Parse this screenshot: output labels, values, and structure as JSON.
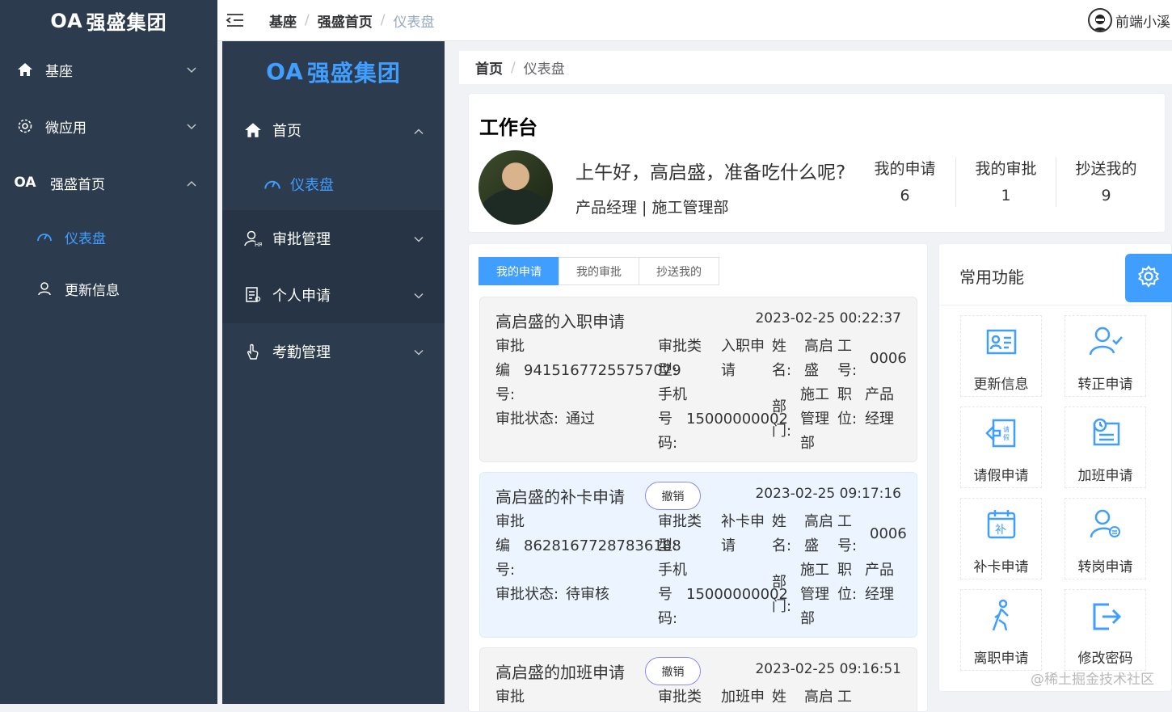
{
  "sidebar1": {
    "logo": "强盛集团",
    "logo_prefix": "OA",
    "items": [
      {
        "label": "基座"
      },
      {
        "label": "微应用"
      },
      {
        "label": "强盛首页"
      }
    ],
    "subitems": [
      {
        "label": "仪表盘"
      },
      {
        "label": "更新信息"
      }
    ]
  },
  "sidebar2": {
    "logo": "强盛集团",
    "logo_prefix": "OA",
    "items": [
      {
        "label": "首页"
      },
      {
        "label": "审批管理"
      },
      {
        "label": "个人申请"
      },
      {
        "label": "考勤管理"
      }
    ],
    "subitems": [
      {
        "label": "仪表盘"
      }
    ]
  },
  "topbar": {
    "crumbs": [
      "基座",
      "强盛首页",
      "仪表盘"
    ],
    "sep": "/",
    "user": "前端小溪"
  },
  "crumb2": {
    "items": [
      "首页",
      "仪表盘"
    ],
    "sep": "/"
  },
  "workbench": {
    "title": "工作台",
    "greeting": "上午好，高启盛，准备吃什么呢?",
    "role": "产品经理 | 施工管理部",
    "stats": [
      {
        "label": "我的申请",
        "value": "6"
      },
      {
        "label": "我的审批",
        "value": "1"
      },
      {
        "label": "抄送我的",
        "value": "9"
      }
    ]
  },
  "tabs": [
    "我的申请",
    "我的审批",
    "抄送我的"
  ],
  "applications": [
    {
      "title": "高启盛的入职申请",
      "time": "2023-02-25 00:22:37",
      "cancel": "",
      "no_label_1": "审批",
      "no_label_2": "编",
      "no_label_3": "号:",
      "no_value": "94151677255757079",
      "type_label": "审批类型:",
      "type_label_a": "审批类",
      "type_label_b": "型:",
      "type_value_a": "入职申",
      "type_value_b": "请",
      "name_label_a": "姓",
      "name_label_b": "名:",
      "name_value_a": "高启",
      "name_value_b": "盛",
      "empno_label_a": "工",
      "empno_label_b": "号:",
      "empno_value": "0006",
      "status": "审批状态:通过",
      "status_label": "审批状态:",
      "status_value": "通过",
      "phone_label_a": "手机",
      "phone_label_b": "号",
      "phone_label_c": "码:",
      "phone_value": "15000000002",
      "dept_label_a": "部",
      "dept_label_b": "门:",
      "dept_value_a": "施工",
      "dept_value_b": "管理",
      "dept_value_c": "部",
      "pos_label_a": "职",
      "pos_label_b": "位:",
      "pos_value_a": "产品",
      "pos_value_b": "经理"
    },
    {
      "title": "高启盛的补卡申请",
      "time": "2023-02-25 09:17:16",
      "cancel": "撤销",
      "no_label_1": "审批",
      "no_label_2": "编",
      "no_label_3": "号:",
      "no_value": "86281677287836188",
      "type_label_a": "审批类",
      "type_label_b": "型:",
      "type_value_a": "补卡申",
      "type_value_b": "请",
      "name_label_a": "姓",
      "name_label_b": "名:",
      "name_value_a": "高启",
      "name_value_b": "盛",
      "empno_label_a": "工",
      "empno_label_b": "号:",
      "empno_value": "0006",
      "status_label": "审批状态:",
      "status_value": "待审核",
      "phone_label_a": "手机",
      "phone_label_b": "号",
      "phone_label_c": "码:",
      "phone_value": "15000000002",
      "dept_label_a": "部",
      "dept_label_b": "门:",
      "dept_value_a": "施工",
      "dept_value_b": "管理",
      "dept_value_c": "部",
      "pos_label_a": "职",
      "pos_label_b": "位:",
      "pos_value_a": "产品",
      "pos_value_b": "经理"
    },
    {
      "title": "高启盛的加班申请",
      "time": "2023-02-25 09:16:51",
      "cancel": "撤销",
      "no_label_1": "审批",
      "type_label_a": "审批类",
      "type_value_a": "加班申",
      "name_label_a": "姓",
      "name_value_a": "高启",
      "empno_label_a": "工"
    }
  ],
  "functions": {
    "title": "常用功能",
    "items": [
      {
        "label": "更新信息",
        "icon": "id-card-icon"
      },
      {
        "label": "转正申请",
        "icon": "user-check-icon"
      },
      {
        "label": "请假申请",
        "icon": "leave-icon"
      },
      {
        "label": "加班申请",
        "icon": "overtime-icon"
      },
      {
        "label": "补卡申请",
        "icon": "calendar-icon"
      },
      {
        "label": "转岗申请",
        "icon": "user-transfer-icon"
      },
      {
        "label": "离职申请",
        "icon": "walk-icon"
      },
      {
        "label": "修改密码",
        "icon": "logout-icon"
      }
    ]
  },
  "watermark": "@稀土掘金技术社区",
  "colors": {
    "accent": "#409eff",
    "sidebar": "#2d3b4e",
    "sidebar_dark": "#263445"
  }
}
